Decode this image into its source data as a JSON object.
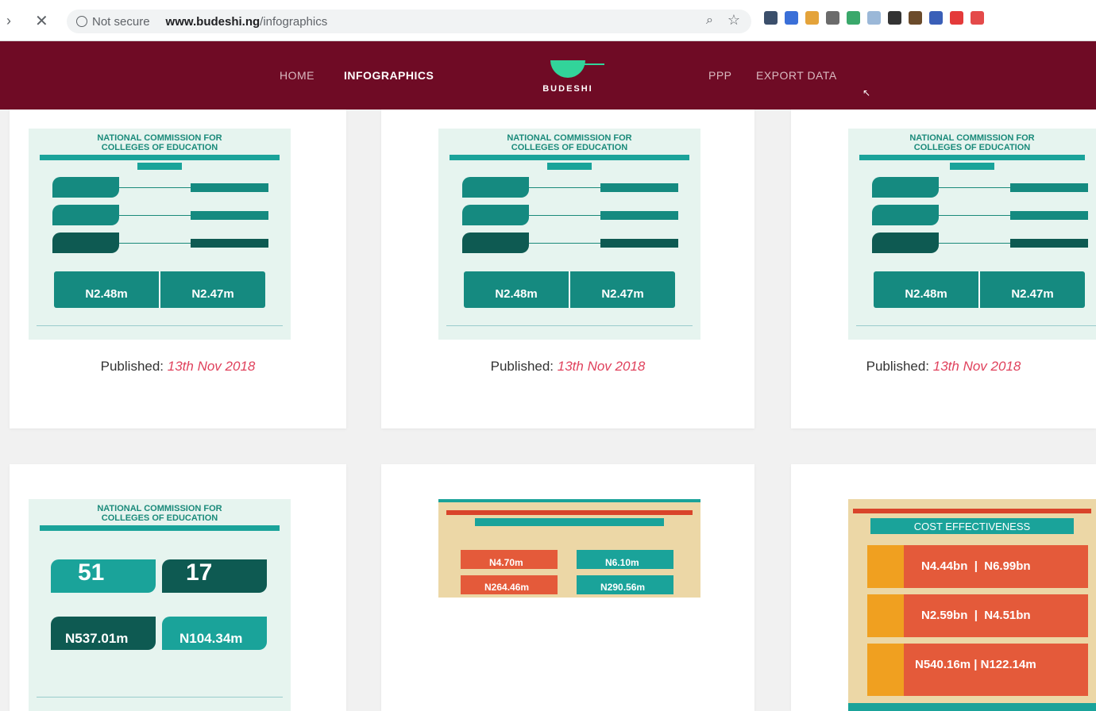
{
  "browser": {
    "security_text": "Not secure",
    "url_domain": "www.budeshi.ng",
    "url_path": "/infographics",
    "icons": [
      "forward-icon",
      "close-icon",
      "info-icon",
      "zoom-icon",
      "star-icon"
    ],
    "extensions": [
      "#3b4f6b",
      "#3a6fd8",
      "#e4a33a",
      "#6b6b6b",
      "#3aa86b",
      "#9bb8d8",
      "#333333",
      "#6b4b2b",
      "#3a5fb8",
      "#e43a3a",
      "#e44a4a"
    ]
  },
  "site": {
    "nav": {
      "home": "HOME",
      "infographics": "INFOGRAPHICS",
      "ppp": "PPP",
      "export": "EXPORT DATA"
    },
    "logo_text": "BUDESHI",
    "colors": {
      "header": "#6f0b25",
      "accent": "#32d49a"
    }
  },
  "cards": [
    {
      "published_label": "Published:",
      "published_date": "13th Nov 2018",
      "title_line1": "NATIONAL COMMISSION FOR",
      "title_line2": "COLLEGES OF EDUCATION",
      "amount_left": "N2.48m",
      "amount_right": "N2.47m"
    },
    {
      "published_label": "Published:",
      "published_date": "13th Nov 2018",
      "title_line1": "NATIONAL COMMISSION FOR",
      "title_line2": "COLLEGES OF EDUCATION",
      "amount_left": "N2.48m",
      "amount_right": "N2.47m"
    },
    {
      "published_label": "Published:",
      "published_date": "13th Nov 2018",
      "title_line1": "NATIONAL COMMISSION FOR",
      "title_line2": "COLLEGES OF EDUCATION",
      "amount_left": "N2.48m",
      "amount_right": "N2.47m"
    },
    {
      "title_line1": "NATIONAL COMMISSION FOR",
      "title_line2": "COLLEGES OF EDUCATION",
      "count_a": "51",
      "count_b": "17",
      "amount_left": "N537.01m",
      "amount_right": "N104.34m"
    },
    {
      "amount_a": "N4.70m",
      "amount_b": "N6.10m",
      "amount_c": "N264.46m",
      "amount_d": "N290.56m"
    },
    {
      "title": "COST EFFECTIVENESS",
      "amount_1a": "N4.44bn",
      "amount_1b": "N6.99bn",
      "amount_2a": "N2.59bn",
      "amount_2b": "N4.51bn",
      "amount_3a": "N540.16m",
      "amount_3b": "N122.14m"
    }
  ]
}
